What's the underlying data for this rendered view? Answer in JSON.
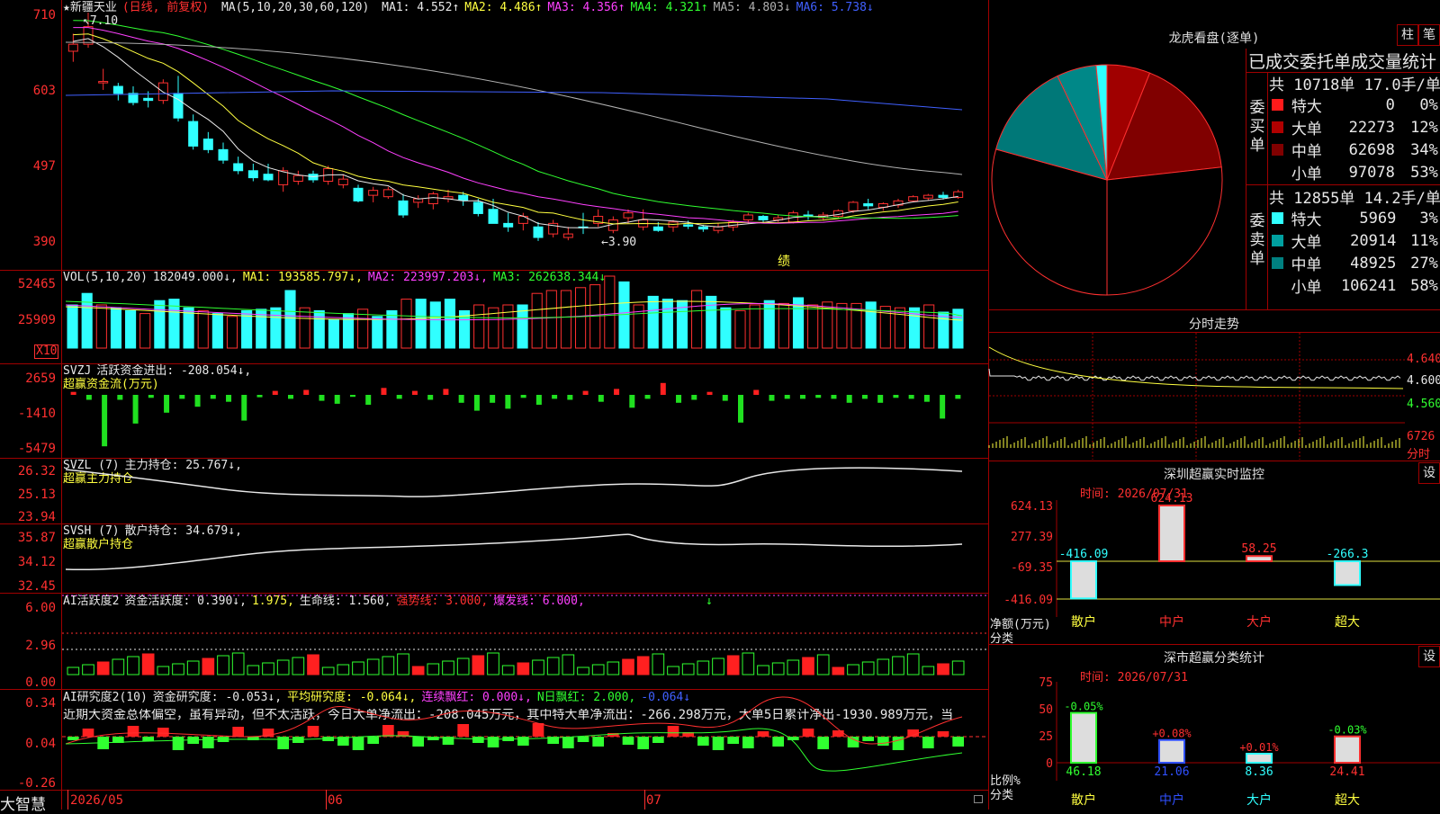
{
  "main": {
    "name": "★新疆天业",
    "period": "(日线, 前复权)",
    "ma_label": "MA(5,10,20,30,60,120)",
    "ma": [
      {
        "label": "MA1:",
        "value": "4.552",
        "arrow": "↑",
        "color": "#e8e8e8"
      },
      {
        "label": "MA2:",
        "value": "4.486",
        "arrow": "↑",
        "color": "#ffff40"
      },
      {
        "label": "MA3:",
        "value": "4.356",
        "arrow": "↑",
        "color": "#ff40ff"
      },
      {
        "label": "MA4:",
        "value": "4.321",
        "arrow": "↑",
        "color": "#30ff30"
      },
      {
        "label": "MA5:",
        "value": "4.803",
        "arrow": "↓",
        "color": "#b0b0b0"
      },
      {
        "label": "MA6:",
        "value": "5.738",
        "arrow": "↓",
        "color": "#4060ff"
      }
    ],
    "yticks": [
      "710",
      "603",
      "497",
      "390"
    ],
    "high_label": "7.10",
    "low_label": "←3.90",
    "event_mark": "绩",
    "candles": [
      [
        6.55,
        6.8,
        6.4,
        6.65
      ],
      [
        6.65,
        7.1,
        6.6,
        6.9
      ],
      [
        6.1,
        6.3,
        6.0,
        6.12
      ],
      [
        6.05,
        6.1,
        5.85,
        5.95
      ],
      [
        5.95,
        6.05,
        5.78,
        5.82
      ],
      [
        5.88,
        5.98,
        5.75,
        5.85
      ],
      [
        5.85,
        6.15,
        5.8,
        6.1
      ],
      [
        5.95,
        6.2,
        5.55,
        5.6
      ],
      [
        5.55,
        5.65,
        5.15,
        5.2
      ],
      [
        5.3,
        5.4,
        5.1,
        5.15
      ],
      [
        5.15,
        5.25,
        4.95,
        5.0
      ],
      [
        4.95,
        5.05,
        4.8,
        4.85
      ],
      [
        4.85,
        4.95,
        4.7,
        4.75
      ],
      [
        4.8,
        4.95,
        4.7,
        4.72
      ],
      [
        4.65,
        4.9,
        4.55,
        4.85
      ],
      [
        4.7,
        4.85,
        4.65,
        4.78
      ],
      [
        4.8,
        4.85,
        4.68,
        4.72
      ],
      [
        4.7,
        4.92,
        4.65,
        4.88
      ],
      [
        4.65,
        4.8,
        4.6,
        4.73
      ],
      [
        4.6,
        4.65,
        4.4,
        4.42
      ],
      [
        4.5,
        4.62,
        4.4,
        4.57
      ],
      [
        4.48,
        4.62,
        4.45,
        4.58
      ],
      [
        4.42,
        4.52,
        4.18,
        4.22
      ],
      [
        4.4,
        4.5,
        4.32,
        4.45
      ],
      [
        4.38,
        4.55,
        4.3,
        4.52
      ],
      [
        4.45,
        4.58,
        4.4,
        4.48
      ],
      [
        4.5,
        4.55,
        4.35,
        4.43
      ],
      [
        4.4,
        4.45,
        4.2,
        4.24
      ],
      [
        4.3,
        4.45,
        4.15,
        4.1
      ],
      [
        4.1,
        4.25,
        3.98,
        4.05
      ],
      [
        4.1,
        4.25,
        4.0,
        4.2
      ],
      [
        4.05,
        4.12,
        3.85,
        3.9
      ],
      [
        3.95,
        4.15,
        3.9,
        4.1
      ],
      [
        3.9,
        4.05,
        3.86,
        3.95
      ],
      [
        4.05,
        4.25,
        3.95,
        4.04
      ],
      [
        4.1,
        4.3,
        4.05,
        4.2
      ],
      [
        4.0,
        4.2,
        3.96,
        4.15
      ],
      [
        4.18,
        4.3,
        4.1,
        4.25
      ],
      [
        4.05,
        4.3,
        4.0,
        4.15
      ],
      [
        4.05,
        4.12,
        3.98,
        4.0
      ],
      [
        4.05,
        4.15,
        3.98,
        4.12
      ],
      [
        4.08,
        4.14,
        4.02,
        4.06
      ],
      [
        4.05,
        4.08,
        3.98,
        4.02
      ],
      [
        4.0,
        4.1,
        3.96,
        4.05
      ],
      [
        4.05,
        4.15,
        3.99,
        4.12
      ],
      [
        4.15,
        4.25,
        4.1,
        4.22
      ],
      [
        4.2,
        4.22,
        4.1,
        4.15
      ],
      [
        4.15,
        4.22,
        4.12,
        4.18
      ],
      [
        4.12,
        4.28,
        4.1,
        4.25
      ],
      [
        4.22,
        4.28,
        4.15,
        4.2
      ],
      [
        4.18,
        4.26,
        4.14,
        4.22
      ],
      [
        4.2,
        4.3,
        4.18,
        4.28
      ],
      [
        4.28,
        4.42,
        4.25,
        4.4
      ],
      [
        4.38,
        4.45,
        4.3,
        4.35
      ],
      [
        4.33,
        4.4,
        4.28,
        4.38
      ],
      [
        4.36,
        4.45,
        4.32,
        4.42
      ],
      [
        4.42,
        4.5,
        4.4,
        4.48
      ],
      [
        4.46,
        4.52,
        4.43,
        4.5
      ],
      [
        4.5,
        4.55,
        4.44,
        4.47
      ],
      [
        4.47,
        4.58,
        4.45,
        4.55
      ]
    ]
  },
  "volume": {
    "label": "VOL(5,10,20)",
    "value": "182049.000↓,",
    "ma1": "MA1: 193585.797↓,",
    "ma2": "MA2: 223997.203↓,",
    "ma3": "MA3: 262638.344↓",
    "yticks": [
      "52465",
      "25909"
    ],
    "unit": "X10",
    "bars": [
      30,
      38,
      30,
      28,
      26,
      24,
      33,
      34,
      28,
      26,
      24,
      22,
      26,
      27,
      28,
      40,
      28,
      26,
      20,
      24,
      27,
      22,
      26,
      34,
      34,
      32,
      34,
      26,
      30,
      28,
      30,
      30,
      38,
      40,
      40,
      42,
      44,
      50,
      46,
      30,
      36,
      34,
      33,
      40,
      36,
      28,
      26,
      30,
      33,
      31,
      35,
      30,
      32,
      31,
      31,
      32,
      29,
      28,
      28,
      30,
      25,
      27
    ],
    "bar_color": [
      "c",
      "c",
      "r",
      "c",
      "c",
      "r",
      "c",
      "c",
      "c",
      "r",
      "c",
      "r",
      "c",
      "c",
      "c",
      "c",
      "r",
      "c",
      "c",
      "c",
      "r",
      "c",
      "c",
      "r",
      "c",
      "c",
      "c",
      "c",
      "r",
      "r",
      "r",
      "c",
      "r",
      "r",
      "r",
      "r",
      "r",
      "r",
      "c",
      "r",
      "c",
      "c",
      "c",
      "r",
      "c",
      "c",
      "r",
      "r",
      "c",
      "r",
      "c",
      "r",
      "r",
      "r",
      "r",
      "c",
      "r",
      "r",
      "c",
      "r",
      "c",
      "c"
    ]
  },
  "svzj": {
    "label": "SVZJ",
    "desc": "活跃资金进出: -208.054↓,",
    "sub": "超赢资金流(万元)",
    "yticks": [
      "2659",
      "-1410",
      "-5479"
    ],
    "values": [
      150,
      -250,
      -2600,
      -250,
      -1450,
      -150,
      -900,
      -200,
      -600,
      -200,
      -350,
      -1300,
      -120,
      200,
      -200,
      250,
      -300,
      -450,
      -100,
      -500,
      350,
      -200,
      200,
      -250,
      300,
      -400,
      -800,
      -400,
      -700,
      -150,
      -500,
      -200,
      -250,
      200,
      -350,
      300,
      -650,
      -200,
      600,
      -400,
      -250,
      150,
      -300,
      -1400,
      250,
      -300,
      -200,
      -200,
      -150,
      -200,
      -400,
      -200,
      -400,
      -150,
      -200,
      -350,
      -1200,
      -200
    ],
    "sel_val": 0
  },
  "svzl": {
    "label": "SVZL (7)",
    "desc": "主力持仓: 25.767↓,",
    "sub": "超赢主力持仓",
    "yticks": [
      "26.32",
      "25.13",
      "23.94"
    ]
  },
  "svsh": {
    "label": "SVSH (7)",
    "desc": "散户持仓: 34.679↓,",
    "sub": "超赢散户持仓",
    "yticks": [
      "35.87",
      "34.12",
      "32.45"
    ]
  },
  "ai_active": {
    "label": "AI活跃度2",
    "desc1": "资金活跃度: 0.390↓,",
    "desc2": "1.975,",
    "desc3": "生命线: 1.560,",
    "desc4": "强势线: 3.000,",
    "desc5": "爆发线: 6.000,",
    "yticks": [
      "6.00",
      "2.96",
      "0.00"
    ],
    "marker": "↓"
  },
  "ai_research": {
    "label": "AI研究度2(10)",
    "desc1": "资金研究度: -0.053↓,",
    "desc2": "平均研究度: -0.064↓,",
    "desc3": "连续飘红: 0.000↓,",
    "desc4": "N日飘红: 2.000,",
    "desc5": "-0.064↓",
    "summary": "近期大资金总体偏空，虽有异动，但不太活跃，今日大单净流出：-208.045万元，其中特大单净流出：-266.298万元，大单5日累计净出-1930.989万元，当",
    "yticks": [
      "0.34",
      "0.04",
      "-0.26"
    ]
  },
  "xaxis": {
    "labels": [
      "2026/05",
      "06",
      "07"
    ]
  },
  "brand": "大智慧",
  "longhu": {
    "title": "龙虎看盘(逐单)",
    "btn1": "柱",
    "btn2": "笔",
    "table_title": "已成交委托单成交量统计",
    "buy_label": "委买单",
    "sell_label": "委卖单",
    "buy_total": "共 10718单 17.0手/单",
    "sell_total": "共 12855单 14.2手/单",
    "buy": [
      {
        "name": "特大",
        "vol": "0",
        "pct": "0%",
        "color": "#ff1a1a"
      },
      {
        "name": "大单",
        "vol": "22273",
        "pct": "12%",
        "color": "#b00000"
      },
      {
        "name": "中单",
        "vol": "62698",
        "pct": "34%",
        "color": "#800000"
      },
      {
        "name": "小单",
        "vol": "97078",
        "pct": "53%",
        "color": "#000000"
      }
    ],
    "sell": [
      {
        "name": "特大",
        "vol": "5969",
        "pct": "3%",
        "color": "#30ffff"
      },
      {
        "name": "大单",
        "vol": "20914",
        "pct": "11%",
        "color": "#00a0a0"
      },
      {
        "name": "中单",
        "vol": "48925",
        "pct": "27%",
        "color": "#008080"
      },
      {
        "name": "小单",
        "vol": "106241",
        "pct": "58%",
        "color": "#000000"
      }
    ]
  },
  "fenshi": {
    "title": "分时走势",
    "yticks": [
      "4.640",
      "4.600",
      "4.560"
    ],
    "vol_tick": "6726",
    "vol_label": "分时"
  },
  "monitor": {
    "title": "深圳超赢实时监控",
    "set_btn": "设",
    "time": "时间: 2026/07/31",
    "yticks": [
      "624.13",
      "277.39",
      "-69.35",
      "-416.09"
    ],
    "ylabel1": "净额(万元)",
    "ylabel2": "分类",
    "cats": [
      "散户",
      "中户",
      "大户",
      "超大"
    ],
    "values": [
      -416.09,
      624.13,
      58.25,
      -266.3
    ],
    "value_labels": [
      "-416.09",
      "624.13",
      "58.25",
      "-266.3"
    ]
  },
  "classify": {
    "title": "深市超赢分类统计",
    "set_btn": "设",
    "time": "时间: 2026/07/31",
    "yticks": [
      "75",
      "50",
      "25",
      "0"
    ],
    "ylabel1": "比例%",
    "ylabel2": "分类",
    "cats": [
      "散户",
      "中户",
      "大户",
      "超大"
    ],
    "values": [
      46.18,
      21.06,
      8.36,
      24.41
    ],
    "changes": [
      "-0.05%",
      "+0.08%",
      "+0.01%",
      "-0.03%"
    ]
  }
}
